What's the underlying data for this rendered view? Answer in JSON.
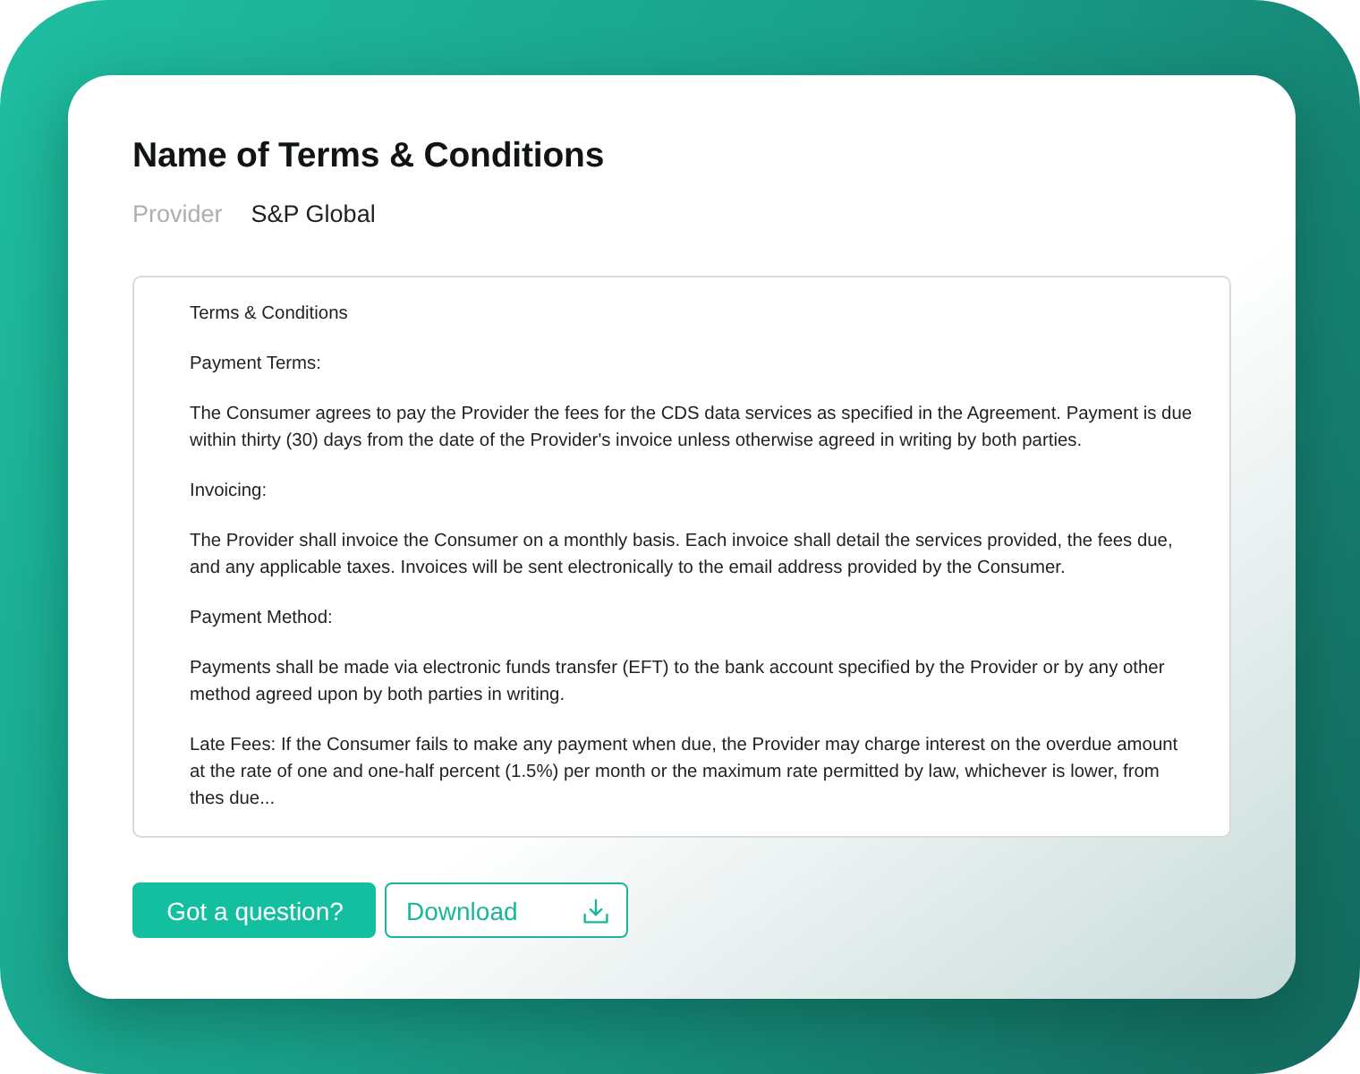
{
  "title": "Name of Terms & Conditions",
  "provider": {
    "label": "Provider",
    "value": "S&P Global"
  },
  "terms": {
    "paragraphs": [
      "Terms & Conditions",
      "Payment Terms:",
      "The Consumer agrees to pay the Provider the fees for the CDS data services as specified in the Agreement. Payment is due within thirty (30) days from the date of the Provider's invoice unless otherwise agreed in writing by both parties.",
      "Invoicing:",
      "The Provider shall invoice the Consumer on a monthly basis. Each invoice shall detail the services provided, the fees due, and any applicable taxes. Invoices will be sent electronically to the email address provided by the Consumer.",
      "Payment Method:",
      "Payments shall be made via electronic funds transfer (EFT) to the bank account specified by the Provider or by any other method agreed upon by both parties in writing.",
      "Late Fees: If the Consumer fails to make any payment when due, the Provider may charge interest on the overdue amount at the rate of one and one-half percent (1.5%) per month or the maximum rate permitted by law, whichever is lower, from thes due..."
    ]
  },
  "buttons": [
    {
      "kind": "primary",
      "label": "Got a question?"
    },
    {
      "kind": "download",
      "label": "Download"
    }
  ]
}
